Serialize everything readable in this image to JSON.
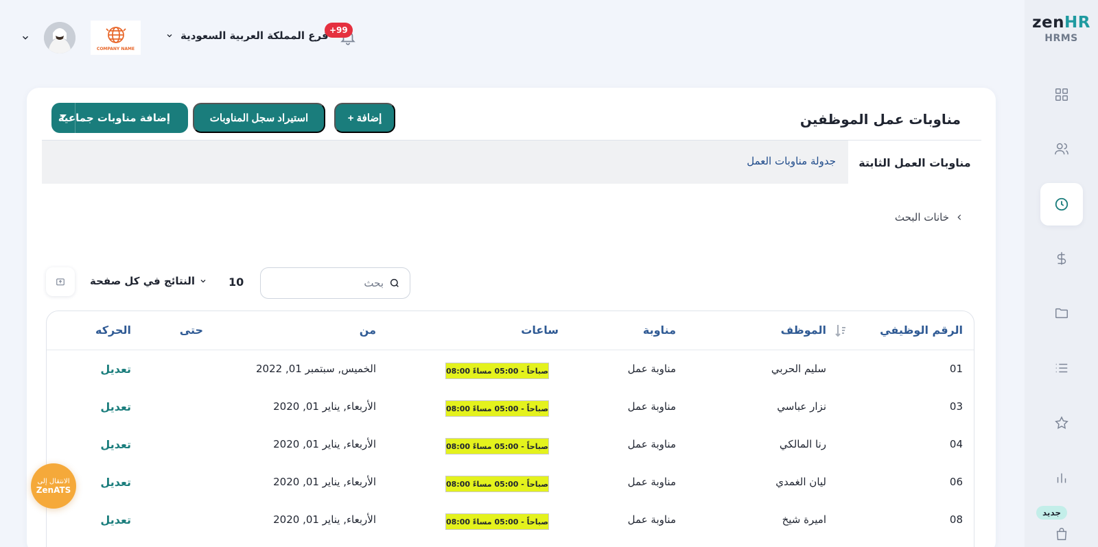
{
  "brand": {
    "logo_zen": "zen",
    "logo_hr": "HR",
    "product": "HRMS"
  },
  "sidebar": {
    "items": [
      {
        "icon": "dashboard-grid-icon"
      },
      {
        "icon": "users-icon"
      },
      {
        "icon": "clock-icon",
        "active": true
      },
      {
        "icon": "dollar-icon"
      },
      {
        "icon": "folder-icon"
      },
      {
        "icon": "list-icon"
      },
      {
        "icon": "star-icon"
      },
      {
        "icon": "bar-chart-icon"
      },
      {
        "icon": "shopping-bag-icon"
      }
    ],
    "new_badge": "جديد"
  },
  "header": {
    "branch": "فرع المملكة العربية السعودية",
    "notifications": "+99",
    "company_logo_text": "COMPANY NAME"
  },
  "page": {
    "title": "مناوبات عمل الموظفين",
    "buttons": {
      "add": "+ إضافة",
      "import": "استيراد سجل المناوبات",
      "bulk": "إضافة مناوبات جماعية"
    },
    "tabs": [
      {
        "label": "مناوبات العمل الثابتة",
        "active": true
      },
      {
        "label": "جدولة مناوبات العمل",
        "active": false
      }
    ],
    "search_toggle": "خانات البحث",
    "search_placeholder": "بحث",
    "per_page_count": "10",
    "per_page_label": "النتائج في كل صفحة"
  },
  "table": {
    "headers": {
      "id": "الرقم الوظيفي",
      "employee": "الموظف",
      "shift": "مناوبة",
      "hours": "ساعات",
      "from": "من",
      "to": "حتى",
      "action": "الحركه"
    },
    "rows": [
      {
        "id": "01",
        "employee": "سليم الحربي",
        "shift": "مناوبة عمل",
        "hours": "08:00 صباحاً - 05:00 مساءً",
        "from": "الخميس, سبتمبر 01, 2022",
        "to": "",
        "action": "تعديل"
      },
      {
        "id": "03",
        "employee": "نزار عباسي",
        "shift": "مناوبة عمل",
        "hours": "08:00 صباحاً - 05:00 مساءً",
        "from": "الأربعاء, يناير 01, 2020",
        "to": "",
        "action": "تعديل"
      },
      {
        "id": "04",
        "employee": "رنا المالكي",
        "shift": "مناوبة عمل",
        "hours": "08:00 صباحاً - 05:00 مساءً",
        "from": "الأربعاء, يناير 01, 2020",
        "to": "",
        "action": "تعديل"
      },
      {
        "id": "06",
        "employee": "ليان الغمدي",
        "shift": "مناوبة عمل",
        "hours": "08:00 صباحاً - 05:00 مساءً",
        "from": "الأربعاء, يناير 01, 2020",
        "to": "",
        "action": "تعديل"
      },
      {
        "id": "08",
        "employee": "اميرة شيخ",
        "shift": "مناوبة عمل",
        "hours": "08:00 صباحاً - 05:00 مساءً",
        "from": "الأربعاء, يناير 01, 2020",
        "to": "",
        "action": "تعديل"
      }
    ]
  },
  "ats": {
    "line1": "الانتقال إلى",
    "line2": "ZenATS"
  },
  "colors": {
    "primary": "#1a7d7c",
    "link": "#2f5a94",
    "highlight": "#e4f21d",
    "badge": "#e5303f",
    "ats": "#f5a93a"
  }
}
